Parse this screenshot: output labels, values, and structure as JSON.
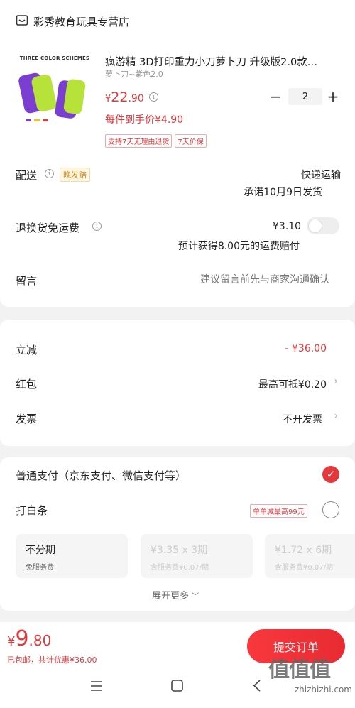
{
  "store": {
    "name": "彩秀教育玩具专营店",
    "icon": "store-icon"
  },
  "product": {
    "image_caption": "THREE COLOR SCHEMES",
    "title": "疯游精  3D打印重力小刀萝卜刀 升级版2.0款…",
    "spec": "萝卜刀~紫色2.0",
    "price_currency": "¥",
    "price_int": "22",
    "price_dec": ".90",
    "unit_price": "每件到手价¥4.90",
    "quantity": "2",
    "minus": "−",
    "plus": "+",
    "tags": [
      "支持7天无理由退货",
      "7天价保"
    ]
  },
  "delivery": {
    "label": "配送",
    "badge": "晚发赔",
    "method": "快递运输",
    "promise": "承诺10月9日发货"
  },
  "return_shipping": {
    "label": "退换货免运费",
    "price": "¥3.10",
    "note": "预计获得8.00元的运费赔付"
  },
  "message": {
    "label": "留言",
    "placeholder": "建议留言前先与商家沟通确认"
  },
  "discounts": {
    "instant": {
      "label": "立减",
      "value": "- ¥36.00"
    },
    "redpacket": {
      "label": "红包",
      "value": "最高可抵¥0.20"
    },
    "invoice": {
      "label": "发票",
      "value": "不开发票"
    }
  },
  "payment": {
    "normal_label": "普通支付（京东支付、微信支付等）",
    "baitiao_label": "打白条",
    "baitiao_promo": "单单减最高99元",
    "installments": [
      {
        "main": "不分期",
        "sub": "免服务费"
      },
      {
        "main": "¥3.35 x 3期",
        "sub": "含服务费¥0.07/期"
      },
      {
        "main": "¥1.72 x 6期",
        "sub": "含服务费¥0.07/期"
      }
    ],
    "expand": "展开更多"
  },
  "footer": {
    "currency": "¥",
    "total_int": "9",
    "total_dec": ".80",
    "summary": "已包邮，共计优惠¥36.00",
    "submit": "提交订单"
  },
  "watermark": {
    "text": "值值值",
    "url": "zhizhizhi.com"
  },
  "colors": {
    "accent": "#e4393c",
    "background": "#f2f2f2"
  }
}
